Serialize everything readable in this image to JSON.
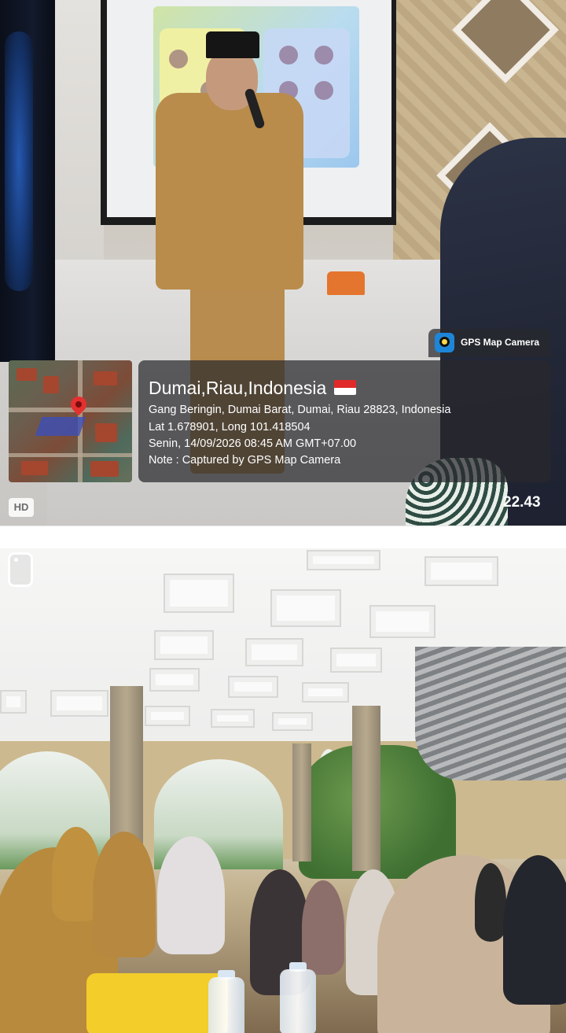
{
  "overlay": {
    "app_badge": "GPS Map Camera",
    "location_title": "Dumai,Riau,Indonesia",
    "address": "Gang Beringin, Dumai Barat, Dumai, Riau 28823, Indonesia",
    "coordinates": "Lat 1.678901, Long 101.418504",
    "datetime": "Senin, 14/09/2026 08:45 AM GMT+07.00",
    "note": "Note : Captured by GPS Map Camera",
    "flag_colors": [
      "#e02a2a",
      "#ffffff"
    ],
    "icons": [
      "gps-camera-app-icon",
      "map-pin-icon",
      "indonesia-flag-icon"
    ]
  },
  "photo_badges": {
    "hd": "HD",
    "time": "22.43"
  },
  "colors": {
    "overlay_bg": "rgba(40,40,44,0.72)",
    "uniform": "#b98c4c",
    "pin": "#e53030"
  }
}
